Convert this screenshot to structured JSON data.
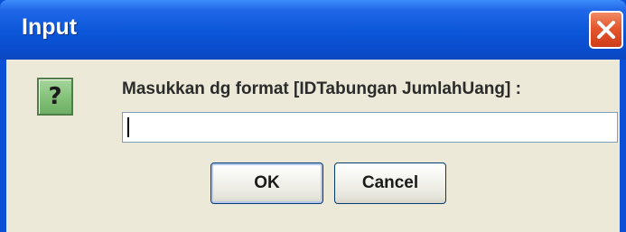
{
  "dialog": {
    "title": "Input",
    "prompt": "Masukkan dg format [IDTabungan JumlahUang] :",
    "input_value": "",
    "ok_label": "OK",
    "cancel_label": "Cancel",
    "icon": "question-icon",
    "icon_glyph": "?",
    "close_icon": "close-icon"
  },
  "colors": {
    "titlebar": "#0a56d8",
    "close_button": "#e4572e",
    "background": "#ece9d8",
    "icon_background": "#80bf75"
  }
}
